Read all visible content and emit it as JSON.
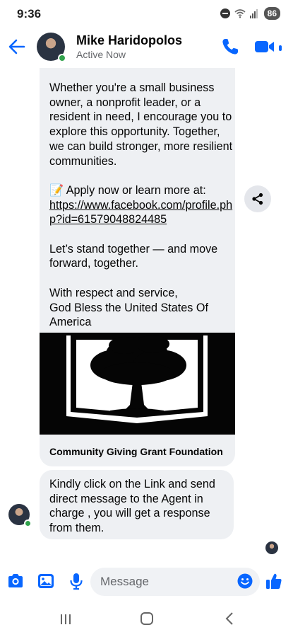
{
  "status_bar": {
    "time": "9:36",
    "battery": "86"
  },
  "header": {
    "name": "Mike Haridopolos",
    "status": "Active Now"
  },
  "message": {
    "paragraph1": "Whether you're a small business owner, a nonprofit leader, or a resident in need, I encourage you to explore this opportunity. Together, we can build stronger, more resilient communities.",
    "apply_text": "📝 Apply now or learn more at:",
    "link": "https://www.facebook.com/profile.php?id=61579048824485",
    "paragraph3": "Let’s stand together — and move forward, together.",
    "closing1": "With respect and service,",
    "closing2": "God Bless the United States Of America"
  },
  "link_preview": {
    "caption": "Community Giving Grant Foundation"
  },
  "message2": {
    "text": "Kindly click on the Link and send direct message to the Agent in charge , you will get a response from them."
  },
  "composer": {
    "placeholder": "Message"
  },
  "colors": {
    "accent": "#0866ff",
    "bubble": "#eef0f3",
    "online": "#31a24c"
  }
}
